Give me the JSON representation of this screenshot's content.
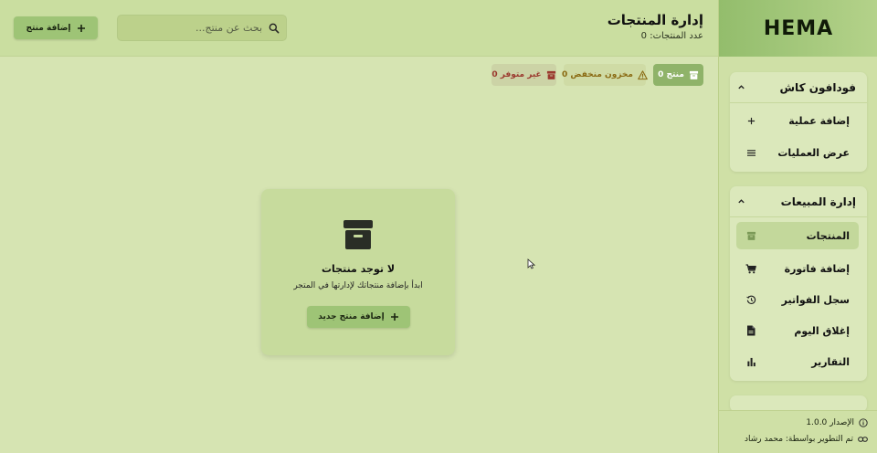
{
  "header": {
    "title": "إدارة المنتجات",
    "count_label": "عدد المنتجات: 0",
    "search_placeholder": "بحث عن منتج...",
    "add_button": "إضافة منتج"
  },
  "filters": {
    "all": "0 منتج",
    "low_stock": "0 مخزون منخفض",
    "out_of_stock": "0 غير متوفر"
  },
  "empty_state": {
    "title": "لا توجد منتجات",
    "subtitle": "ابدأ بإضافة منتجاتك لإدارتها في المتجر",
    "button": "إضافة منتج جديد"
  },
  "sidebar": {
    "brand": "HEMA",
    "sections": [
      {
        "title": "فودافون كاش",
        "items": [
          {
            "label": "إضافة عملية",
            "icon": "plus-icon"
          },
          {
            "label": "عرض العمليات",
            "icon": "list-icon"
          }
        ]
      },
      {
        "title": "إدارة المبيعات",
        "items": [
          {
            "label": "المنتجات",
            "icon": "archive-box-icon",
            "active": true
          },
          {
            "label": "إضافة فاتورة",
            "icon": "cart-icon"
          },
          {
            "label": "سجل الفواتير",
            "icon": "history-icon"
          },
          {
            "label": "إغلاق اليوم",
            "icon": "document-icon"
          },
          {
            "label": "التقارير",
            "icon": "bar-chart-icon"
          }
        ]
      }
    ],
    "footer": {
      "version": "الإصدار 1.0.0",
      "developer": "تم التطوير بواسطة: محمد رشاد"
    }
  },
  "colors": {
    "background": "#d6e4b2",
    "header": "#cadea0",
    "primary_button": "#9ec476",
    "active_chip": "#8fb369",
    "warning_text": "#8a6a12",
    "danger_text": "#9b3a2f"
  }
}
